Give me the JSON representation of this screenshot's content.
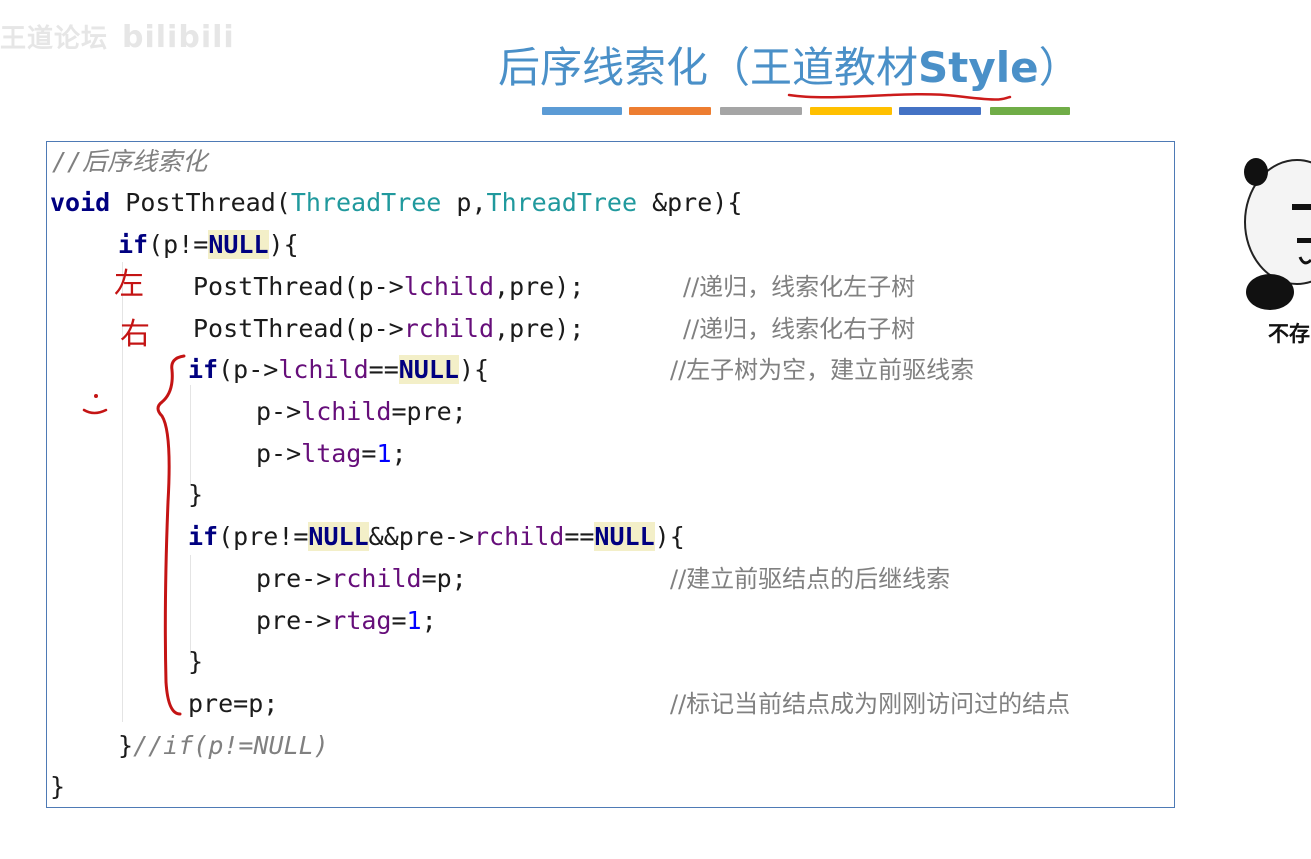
{
  "watermark": {
    "text_left": "王道论坛",
    "text_right": "bilibili"
  },
  "slide": {
    "title_cn": "后序线索化（",
    "title_cn2": "王道教材",
    "title_latin": "Style",
    "title_close": "）"
  },
  "color_bar": [
    "#5b9bd5",
    "#ed7d31",
    "#a5a5a5",
    "#ffc000",
    "#4472c4",
    "#70ad47"
  ],
  "code": {
    "comment_header": "//后序线索化",
    "sig_void": "void",
    "sig_name": " PostThread(",
    "sig_type1": "ThreadTree",
    "sig_p": " p,",
    "sig_type2": "ThreadTree",
    "sig_pre": " &pre){",
    "if1_kw": "if",
    "if1_open": "(p!=",
    "if1_null": "NULL",
    "if1_close": "){",
    "call1": "PostThread(p->",
    "call1_field": "lchild",
    "call1_tail": ",pre);",
    "call1_comment": "//递归，线索化左子树",
    "call2": "PostThread(p->",
    "call2_field": "rchild",
    "call2_tail": ",pre);",
    "call2_comment": "//递归，线索化右子树",
    "if2_kw": "if",
    "if2_open": "(p->",
    "if2_field": "lchild",
    "if2_eq": "==",
    "if2_null": "NULL",
    "if2_close": "){",
    "if2_comment": "//左子树为空，建立前驱线索",
    "assign1_a": "p->",
    "assign1_field": "lchild",
    "assign1_b": "=pre;",
    "assign2_a": "p->",
    "assign2_field": "ltag",
    "assign2_b": "=",
    "assign2_num": "1",
    "assign2_c": ";",
    "brace1": "}",
    "if3_kw": "if",
    "if3_a": "(pre!=",
    "if3_null1": "NULL",
    "if3_b": "&&pre->",
    "if3_field": "rchild",
    "if3_c": "==",
    "if3_null2": "NULL",
    "if3_d": "){",
    "assign3_a": "pre->",
    "assign3_field": "rchild",
    "assign3_b": "=p;",
    "assign3_comment": "//建立前驱结点的后继线索",
    "assign4_a": "pre->",
    "assign4_field": "rtag",
    "assign4_b": "=",
    "assign4_num": "1",
    "assign4_c": ";",
    "brace2": "}",
    "prep": "pre=p;",
    "prep_comment": "//标记当前结点成为刚刚访问过的结点",
    "end_if_brace": "}",
    "end_if_comment": "//if(p!=NULL)",
    "end_fn": "}"
  },
  "panda": {
    "caption": "不存"
  },
  "annotations": {
    "left_mark": "左",
    "right_mark": "右"
  }
}
